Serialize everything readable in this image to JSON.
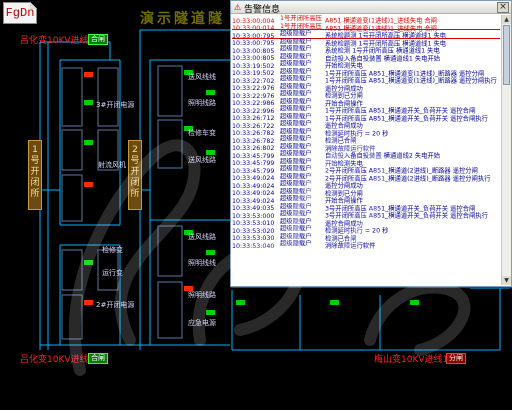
{
  "logo": {
    "text": "FgDn"
  },
  "header": {
    "title": "演示隧道隧"
  },
  "left_side_label": "1号开闭所",
  "mid_side_label": "2号开闭所",
  "top_feed": {
    "label": "吕化变10KV进线2",
    "button": "合闸"
  },
  "bottom_feed_left": {
    "label": "吕化变10KV进线1",
    "button": "合闸"
  },
  "bottom_feed_right": {
    "label": "梅山变10KV进线1",
    "button": "分闸"
  },
  "zones_left": [
    "3#开闭电源",
    "射流风机",
    "检修变",
    "运行变",
    "2#开闭电源"
  ],
  "zones_mid": [
    "送风线线",
    "照明线路",
    "检修车变",
    "送风线路",
    "送风线路",
    "照明线线",
    "照明线路",
    "应急电源"
  ],
  "alert_window": {
    "title": "告警信息",
    "close": "×",
    "rows": [
      {
        "time": "10:33:00:004",
        "dev": "1号开闭所高压",
        "msg": "A851 横通道变(1进线)1_进线失电   合闸",
        "alarm": true
      },
      {
        "time": "10:33:00:014",
        "dev": "1号开闭所高压",
        "msg": "A851 横通道变(1进线)1_进线失电   合闸",
        "alarm": true
      },
      {
        "time": "10:33:00:795",
        "dev": "超级隐载户",
        "msg": "系统检题测 1号开闭所高压 横通道线1 失电",
        "alarm": false,
        "sel": true
      },
      {
        "time": "10:33:00:795",
        "dev": "超级隐载户",
        "msg": "系统检题测 1号开闭所高压 横通道线1 失电",
        "alarm": false
      },
      {
        "time": "10:33:00:805",
        "dev": "超级隐载户",
        "msg": "系统检测 1号开闭所高压 横通道线1 失电",
        "alarm": false
      },
      {
        "time": "10:33:00:805",
        "dev": "超级隐载户",
        "msg": "自动投入备自投装置 横通道线1 失电开始",
        "alarm": false
      },
      {
        "time": "10:33:19:502",
        "dev": "超级隐载户",
        "msg": "开始检测失电",
        "alarm": false
      },
      {
        "time": "10:33:19:502",
        "dev": "超级隐载户",
        "msg": "1号开闭所高压 A851_横通道变(1进线)_断路器  遥控分闸",
        "alarm": false
      },
      {
        "time": "10:33:22:702",
        "dev": "超级隐载户",
        "msg": "1号开闭所高压 A851_横通道变(1进线)_断路器  遥控分闸执行",
        "alarm": false
      },
      {
        "time": "10:33:22:976",
        "dev": "超级隐载户",
        "msg": "遥控分闸成功",
        "alarm": false
      },
      {
        "time": "10:33:22:976",
        "dev": "超级隐载户",
        "msg": "检测到已分闸",
        "alarm": false
      },
      {
        "time": "10:33:22:986",
        "dev": "超级隐载户",
        "msg": "开始合闸操作",
        "alarm": false
      },
      {
        "time": "10:33:22:996",
        "dev": "超级隐载户",
        "msg": "1号开闭所高压 A851_横通道开关_负荷开关  遥控合闸",
        "alarm": false
      },
      {
        "time": "10:33:26:712",
        "dev": "超级隐载户",
        "msg": "1号开闭所高压 A851_横通道开关_负荷开关  遥控合闸执行",
        "alarm": false
      },
      {
        "time": "10:33:26:722",
        "dev": "超级隐载户",
        "msg": "遥控合闸成功",
        "alarm": false
      },
      {
        "time": "10:33:26:782",
        "dev": "超级隐载户",
        "msg": "检测延时执行 = 20 秒",
        "alarm": false
      },
      {
        "time": "10:33:26:782",
        "dev": "超级隐载户",
        "msg": "检测已合闸",
        "alarm": false
      },
      {
        "time": "10:33:26:802",
        "dev": "超级隐载户",
        "msg": "消除故障运行软件",
        "alarm": false
      },
      {
        "time": "10:33:45:799",
        "dev": "超级隐载户",
        "msg": "自动投入备自投装置 横通道线2 失电开始",
        "alarm": false
      },
      {
        "time": "10:33:45:799",
        "dev": "超级隐载户",
        "msg": "开始检测失电",
        "alarm": false
      },
      {
        "time": "10:33:45:799",
        "dev": "超级隐载户",
        "msg": "2号开闭所高压 A851_横通道(2进线)_断路器  遥控分闸",
        "alarm": false
      },
      {
        "time": "10:33:49:024",
        "dev": "超级隐载户",
        "msg": "2号开闭所高压 A851_横通道(2进线)_断路器  遥控分闸执行",
        "alarm": false
      },
      {
        "time": "10:33:49:024",
        "dev": "超级隐载户",
        "msg": "遥控分闸成功",
        "alarm": false
      },
      {
        "time": "10:33:49:024",
        "dev": "超级隐载户",
        "msg": "检测到已分闸",
        "alarm": false
      },
      {
        "time": "10:33:49:024",
        "dev": "超级隐载户",
        "msg": "开始合闸操作",
        "alarm": false
      },
      {
        "time": "10:33:49:035",
        "dev": "超级隐载户",
        "msg": "3号开闭所高压 A851_横通道开关_负荷开关  遥控合闸",
        "alarm": false
      },
      {
        "time": "10:33:53:000",
        "dev": "超级隐载户",
        "msg": "3号开闭所高压 A851_横通道开关_负荷开关  遥控合闸执行",
        "alarm": false
      },
      {
        "time": "10:33:53:010",
        "dev": "超级隐载户",
        "msg": "遥控合闸成功",
        "alarm": false
      },
      {
        "time": "10:33:53:020",
        "dev": "超级隐载户",
        "msg": "检测延时执行 = 20 秒",
        "alarm": false
      },
      {
        "time": "10:33:53:030",
        "dev": "超级隐载户",
        "msg": "检测已合闸",
        "alarm": false
      },
      {
        "time": "10:33:53:040",
        "dev": "超级隐载户",
        "msg": "消除故障运行软件",
        "alarm": false
      }
    ]
  },
  "colors": {
    "bus": "#00b4ff",
    "feed_text": "#ff2020",
    "open": "#ff2a00",
    "closed": "#00d000"
  }
}
